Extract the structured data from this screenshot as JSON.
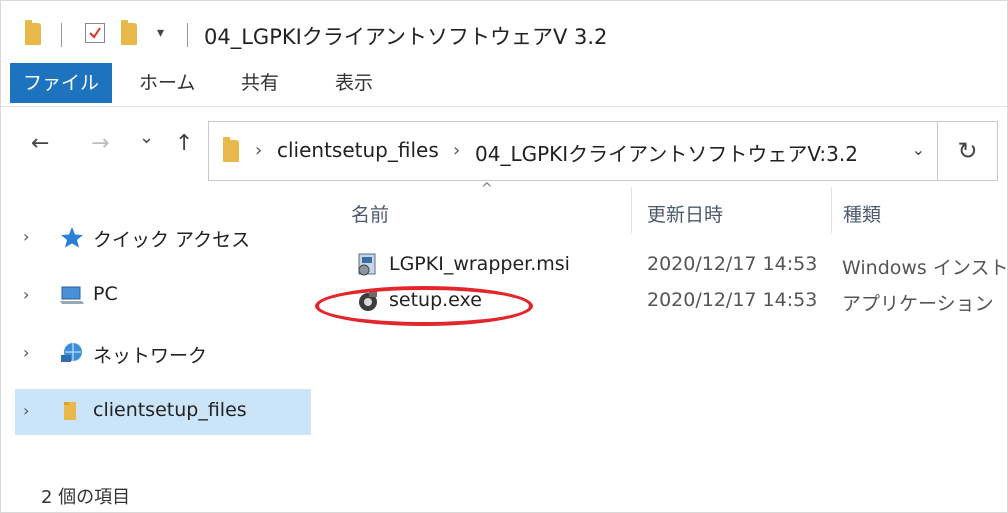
{
  "window": {
    "title": "04_LGPKIクライアントソフトウェアV 3.2",
    "quick_access_dropdown": "▾"
  },
  "ribbon": {
    "tabs": [
      {
        "label": "ファイル",
        "active": true
      },
      {
        "label": "ホーム",
        "active": false
      },
      {
        "label": "共有",
        "active": false
      },
      {
        "label": "表示",
        "active": false
      }
    ]
  },
  "nav": {
    "back": "←",
    "forward": "→",
    "recent": "⌄",
    "up": "↑",
    "breadcrumbs": [
      "clientsetup_files",
      "04_LGPKIクライアントソフトウェアV:3.2"
    ],
    "crumb_separator": "›",
    "dropdown": "⌄",
    "refresh": "↻"
  },
  "navpane": {
    "items": [
      {
        "label": "クイック アクセス",
        "icon": "star-icon",
        "selected": false
      },
      {
        "label": "PC",
        "icon": "pc-icon",
        "selected": false
      },
      {
        "label": "ネットワーク",
        "icon": "network-icon",
        "selected": false
      },
      {
        "label": "clientsetup_files",
        "icon": "folder-icon",
        "selected": true
      }
    ],
    "chevron": "›"
  },
  "files": {
    "sort_indicator": "^",
    "columns": [
      "名前",
      "更新日時",
      "種類"
    ],
    "rows": [
      {
        "name": "LGPKI_wrapper.msi",
        "modified": "2020/12/17 14:53",
        "type": "Windows インストー",
        "icon": "msi-installer-icon"
      },
      {
        "name": "setup.exe",
        "modified": "2020/12/17 14:53",
        "type": "アプリケーション",
        "icon": "setup-exe-icon"
      }
    ]
  },
  "status": {
    "item_count": "2 個の項目"
  },
  "colors": {
    "accent": "#1e73be",
    "selection": "#cce4f7",
    "highlight": "#e3262c"
  }
}
